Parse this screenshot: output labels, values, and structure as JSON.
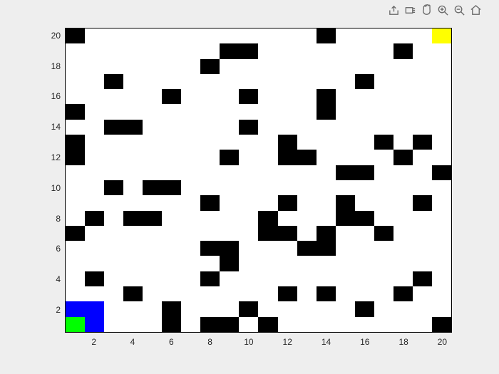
{
  "toolbar": [
    {
      "name": "share-icon"
    },
    {
      "name": "brush-icon"
    },
    {
      "name": "pan-icon"
    },
    {
      "name": "zoom-in-icon"
    },
    {
      "name": "zoom-out-icon"
    },
    {
      "name": "home-icon"
    }
  ],
  "chart_data": {
    "type": "heatmap",
    "title": "",
    "xlabel": "",
    "ylabel": "",
    "xlim": [
      0.5,
      20.5
    ],
    "ylim": [
      0.5,
      20.5
    ],
    "xticks": [
      2,
      4,
      6,
      8,
      10,
      12,
      14,
      16,
      18,
      20
    ],
    "yticks": [
      2,
      4,
      6,
      8,
      10,
      12,
      14,
      16,
      18,
      20
    ],
    "nx": 20,
    "ny": 20,
    "cells": {
      "green": [
        [
          1,
          1
        ]
      ],
      "blue": [
        [
          2,
          1
        ],
        [
          1,
          2
        ],
        [
          2,
          2
        ]
      ],
      "yellow": [
        [
          20,
          20
        ]
      ],
      "black": [
        [
          6,
          1
        ],
        [
          8,
          1
        ],
        [
          9,
          1
        ],
        [
          11,
          1
        ],
        [
          20,
          1
        ],
        [
          6,
          2
        ],
        [
          10,
          2
        ],
        [
          16,
          2
        ],
        [
          4,
          3
        ],
        [
          12,
          3
        ],
        [
          14,
          3
        ],
        [
          18,
          3
        ],
        [
          2,
          4
        ],
        [
          8,
          4
        ],
        [
          19,
          4
        ],
        [
          9,
          5
        ],
        [
          8,
          6
        ],
        [
          9,
          6
        ],
        [
          13,
          6
        ],
        [
          14,
          6
        ],
        [
          1,
          7
        ],
        [
          11,
          7
        ],
        [
          12,
          7
        ],
        [
          14,
          7
        ],
        [
          17,
          7
        ],
        [
          2,
          8
        ],
        [
          4,
          8
        ],
        [
          5,
          8
        ],
        [
          11,
          8
        ],
        [
          15,
          8
        ],
        [
          16,
          8
        ],
        [
          8,
          9
        ],
        [
          12,
          9
        ],
        [
          15,
          9
        ],
        [
          19,
          9
        ],
        [
          3,
          10
        ],
        [
          5,
          10
        ],
        [
          6,
          10
        ],
        [
          15,
          11
        ],
        [
          16,
          11
        ],
        [
          20,
          11
        ],
        [
          1,
          12
        ],
        [
          9,
          12
        ],
        [
          12,
          12
        ],
        [
          13,
          12
        ],
        [
          18,
          12
        ],
        [
          1,
          13
        ],
        [
          12,
          13
        ],
        [
          17,
          13
        ],
        [
          19,
          13
        ],
        [
          3,
          14
        ],
        [
          4,
          14
        ],
        [
          10,
          14
        ],
        [
          1,
          15
        ],
        [
          14,
          15
        ],
        [
          6,
          16
        ],
        [
          10,
          16
        ],
        [
          14,
          16
        ],
        [
          3,
          17
        ],
        [
          16,
          17
        ],
        [
          8,
          18
        ],
        [
          9,
          19
        ],
        [
          10,
          19
        ],
        [
          18,
          19
        ],
        [
          1,
          20
        ],
        [
          14,
          20
        ]
      ]
    }
  },
  "ticks": {
    "x": {
      "2": "2",
      "4": "4",
      "6": "6",
      "8": "8",
      "10": "10",
      "12": "12",
      "14": "14",
      "16": "16",
      "18": "18",
      "20": "20"
    },
    "y": {
      "2": "2",
      "4": "4",
      "6": "6",
      "8": "8",
      "10": "10",
      "12": "12",
      "14": "14",
      "16": "16",
      "18": "18",
      "20": "20"
    }
  }
}
